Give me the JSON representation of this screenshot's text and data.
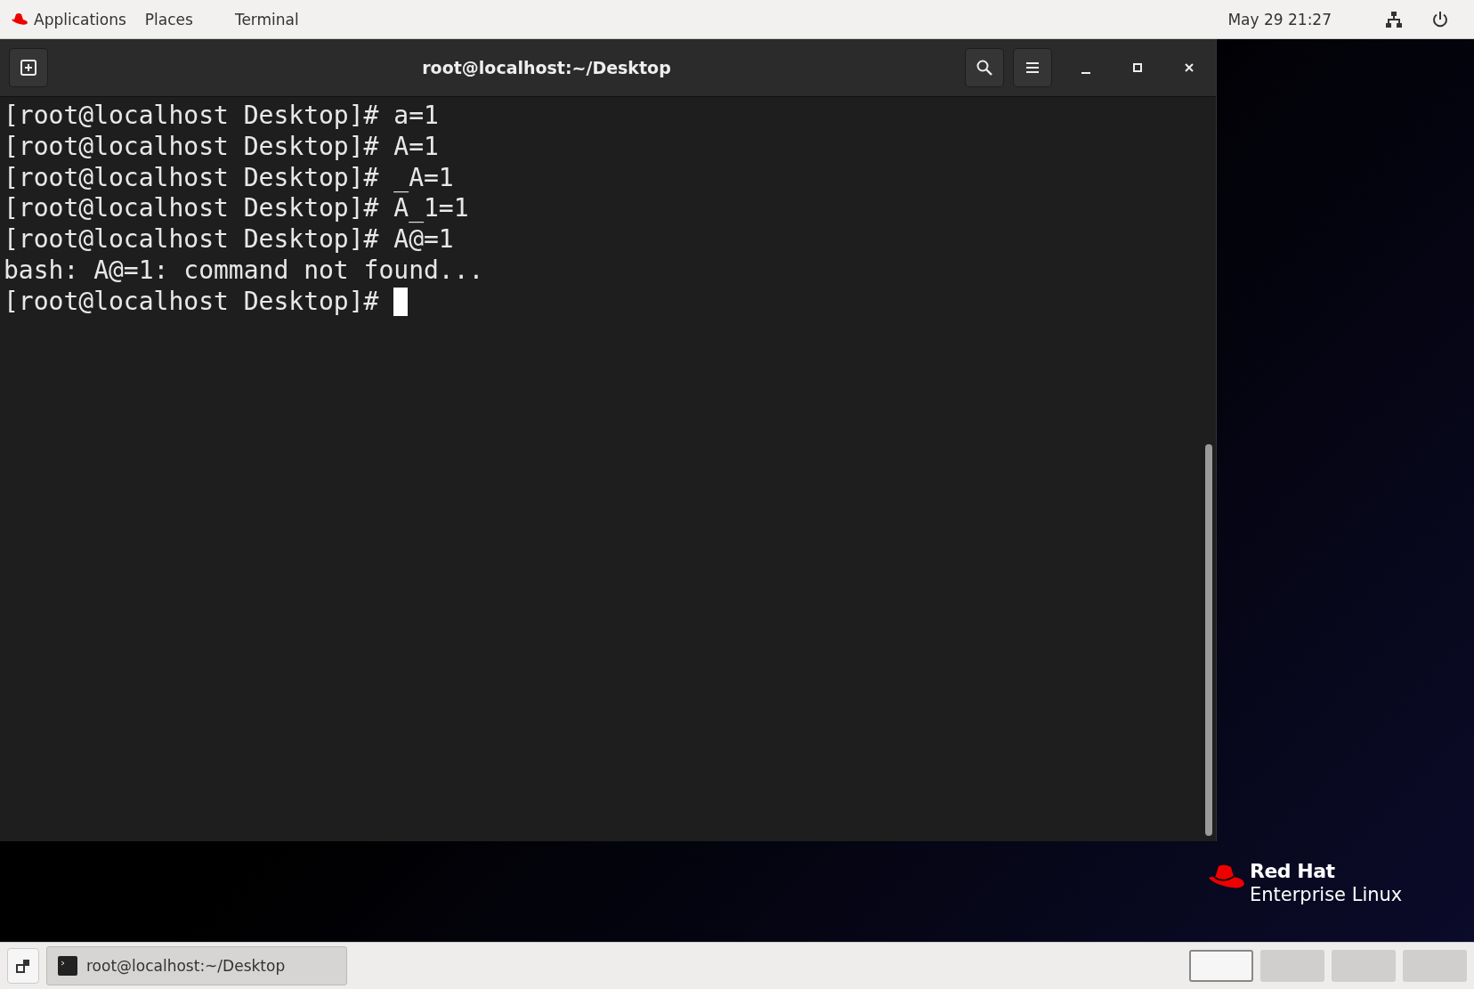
{
  "top_bar": {
    "menus": [
      {
        "label": "Applications",
        "logo": true
      },
      {
        "label": "Places",
        "logo": false
      },
      {
        "label": "Terminal",
        "logo": false
      }
    ],
    "clock": "May 29  21:27"
  },
  "terminal": {
    "title": "root@localhost:~/Desktop",
    "lines": [
      "[root@localhost Desktop]# a=1",
      "[root@localhost Desktop]# A=1",
      "[root@localhost Desktop]# _A=1",
      "[root@localhost Desktop]# A_1=1",
      "[root@localhost Desktop]# A@=1",
      "bash: A@=1: command not found...",
      "[root@localhost Desktop]# "
    ],
    "cursor": true
  },
  "desktop_logo": {
    "brand": "Red Hat",
    "product": "Enterprise Linux"
  },
  "taskbar": {
    "windows": [
      {
        "label": "root@localhost:~/Desktop"
      }
    ],
    "workspaces": [
      {
        "selected": true
      },
      {
        "selected": false
      },
      {
        "selected": false
      },
      {
        "selected": false
      }
    ]
  }
}
